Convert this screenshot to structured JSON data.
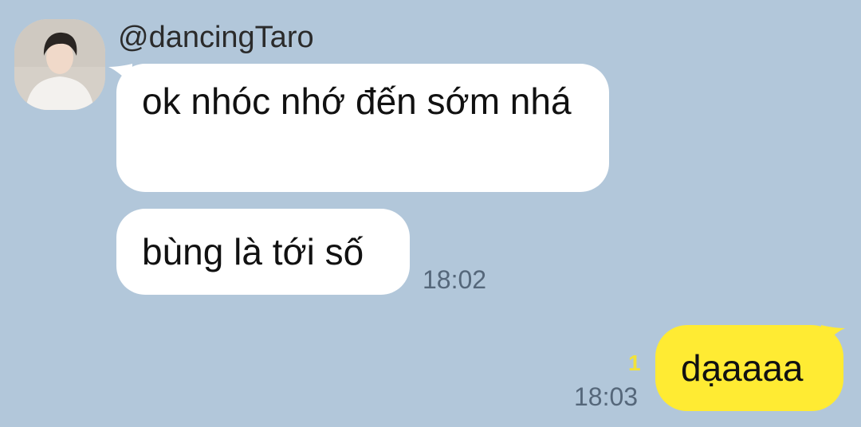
{
  "chat": {
    "sender_name": "@dancingTaro",
    "messages": [
      {
        "sender": "@dancingTaro",
        "text": "ok nhóc nhớ đến sớm nhá"
      },
      {
        "sender": "@dancingTaro",
        "text": "bùng là tới số",
        "time": "18:02"
      },
      {
        "sender": "me",
        "text": "dạaaaa",
        "time": "18:03",
        "unread_count": "1"
      }
    ]
  },
  "icons": {
    "avatar": "profile-photo"
  },
  "colors": {
    "background": "#b2c7da",
    "incoming_bubble": "#ffffff",
    "outgoing_bubble": "#ffeb33",
    "timestamp": "#55677a",
    "unread": "#f2e23a"
  }
}
